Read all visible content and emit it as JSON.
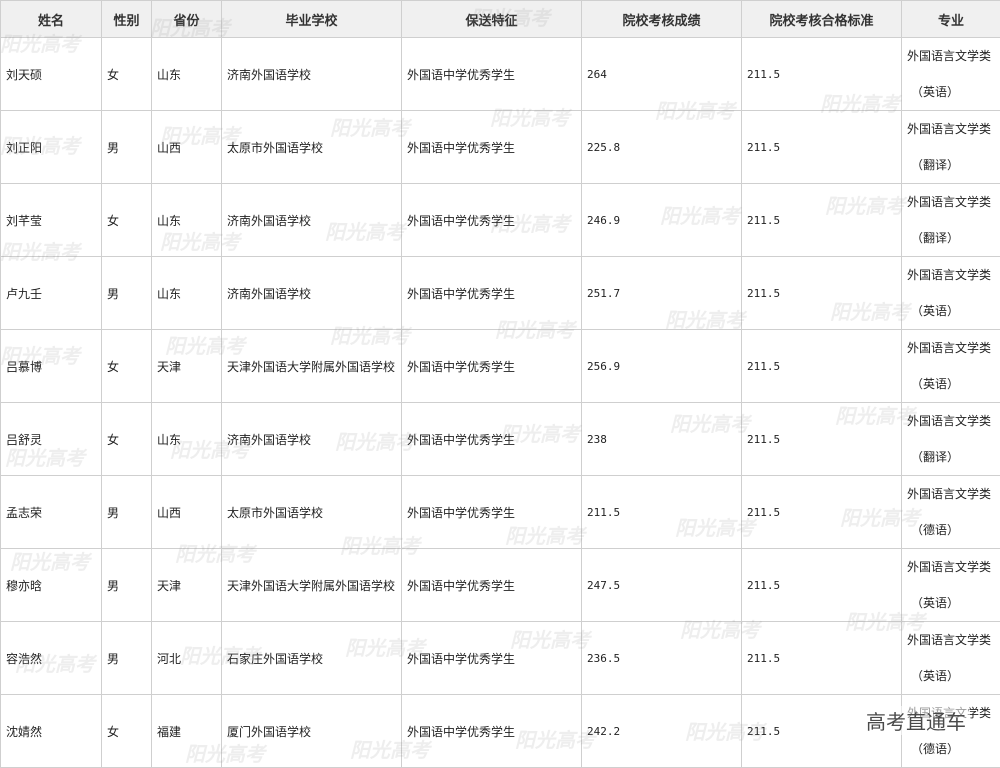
{
  "headers": [
    "姓名",
    "性别",
    "省份",
    "毕业学校",
    "保送特征",
    "院校考核成绩",
    "院校考核合格标准",
    "专业"
  ],
  "rows": [
    {
      "name": "刘天硕",
      "gender": "女",
      "province": "山东",
      "school": "济南外国语学校",
      "feature": "外国语中学优秀学生",
      "score": "264",
      "standard": "211.5",
      "major": "外国语言文学类",
      "track": "（英语）"
    },
    {
      "name": "刘正阳",
      "gender": "男",
      "province": "山西",
      "school": "太原市外国语学校",
      "feature": "外国语中学优秀学生",
      "score": "225.8",
      "standard": "211.5",
      "major": "外国语言文学类",
      "track": "（翻译）"
    },
    {
      "name": "刘芊莹",
      "gender": "女",
      "province": "山东",
      "school": "济南外国语学校",
      "feature": "外国语中学优秀学生",
      "score": "246.9",
      "standard": "211.5",
      "major": "外国语言文学类",
      "track": "（翻译）"
    },
    {
      "name": "卢九壬",
      "gender": "男",
      "province": "山东",
      "school": "济南外国语学校",
      "feature": "外国语中学优秀学生",
      "score": "251.7",
      "standard": "211.5",
      "major": "外国语言文学类",
      "track": "（英语）"
    },
    {
      "name": "吕慕博",
      "gender": "女",
      "province": "天津",
      "school": "天津外国语大学附属外国语学校",
      "feature": "外国语中学优秀学生",
      "score": "256.9",
      "standard": "211.5",
      "major": "外国语言文学类",
      "track": "（英语）"
    },
    {
      "name": "吕舒灵",
      "gender": "女",
      "province": "山东",
      "school": "济南外国语学校",
      "feature": "外国语中学优秀学生",
      "score": "238",
      "standard": "211.5",
      "major": "外国语言文学类",
      "track": "（翻译）"
    },
    {
      "name": "孟志荣",
      "gender": "男",
      "province": "山西",
      "school": "太原市外国语学校",
      "feature": "外国语中学优秀学生",
      "score": "211.5",
      "standard": "211.5",
      "major": "外国语言文学类",
      "track": "（德语）"
    },
    {
      "name": "穆亦晗",
      "gender": "男",
      "province": "天津",
      "school": "天津外国语大学附属外国语学校",
      "feature": "外国语中学优秀学生",
      "score": "247.5",
      "standard": "211.5",
      "major": "外国语言文学类",
      "track": "（英语）"
    },
    {
      "name": "容浩然",
      "gender": "男",
      "province": "河北",
      "school": "石家庄外国语学校",
      "feature": "外国语中学优秀学生",
      "score": "236.5",
      "standard": "211.5",
      "major": "外国语言文学类",
      "track": "（英语）"
    },
    {
      "name": "沈婧然",
      "gender": "女",
      "province": "福建",
      "school": "厦门外国语学校",
      "feature": "外国语中学优秀学生",
      "score": "242.2",
      "standard": "211.5",
      "major": "外国语言文学类",
      "track": "（德语）"
    }
  ],
  "watermark": "阳光高考",
  "brand": "高考直通车"
}
